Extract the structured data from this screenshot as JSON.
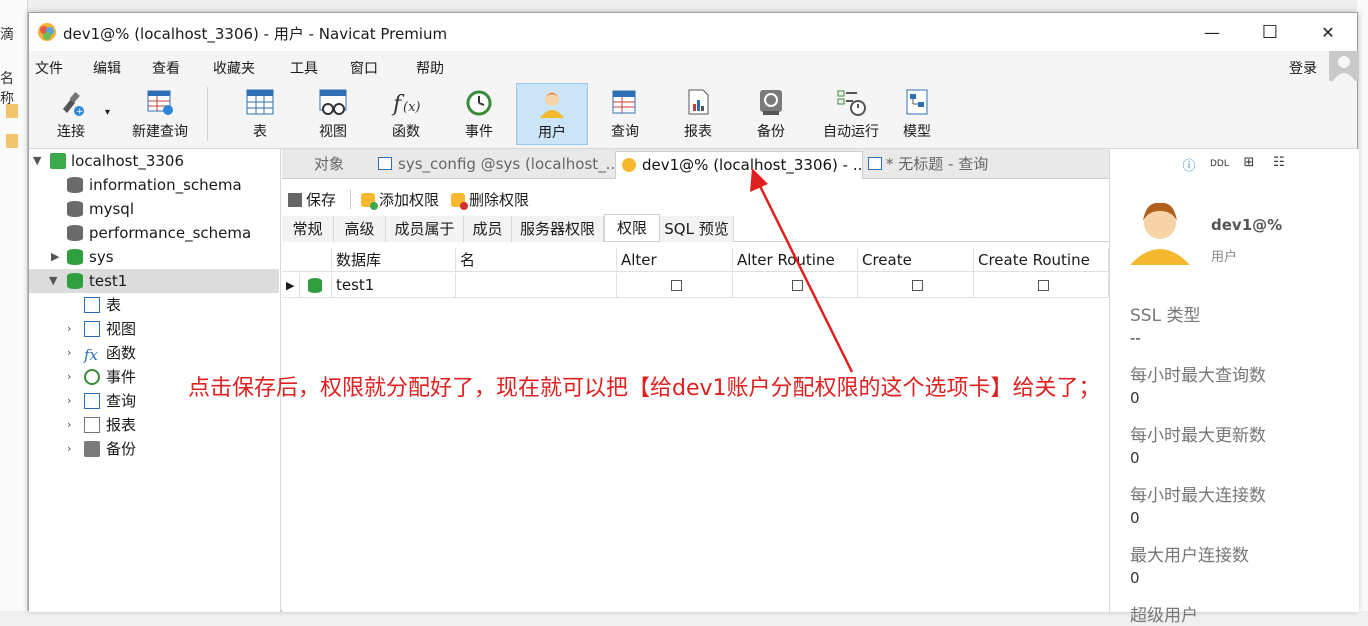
{
  "background": {
    "left_text_1": "滴",
    "left_text_2": "名称"
  },
  "window": {
    "title": "dev1@% (localhost_3306) - 用户 - Navicat Premium",
    "minimize": "—",
    "maximize": "☐",
    "close": "✕"
  },
  "menu": {
    "items": [
      "文件",
      "编辑",
      "查看",
      "收藏夹",
      "工具",
      "窗口",
      "帮助"
    ],
    "login": "登录"
  },
  "toolbar": {
    "items": [
      {
        "label": "连接",
        "icon": "connection-icon"
      },
      {
        "label": "新建查询",
        "icon": "new-query-icon"
      },
      {
        "label": "表",
        "icon": "table-icon"
      },
      {
        "label": "视图",
        "icon": "view-icon"
      },
      {
        "label": "函数",
        "icon": "function-icon"
      },
      {
        "label": "事件",
        "icon": "event-icon"
      },
      {
        "label": "用户",
        "icon": "user-icon"
      },
      {
        "label": "查询",
        "icon": "query-icon"
      },
      {
        "label": "报表",
        "icon": "report-icon"
      },
      {
        "label": "备份",
        "icon": "backup-icon"
      },
      {
        "label": "自动运行",
        "icon": "automation-icon"
      },
      {
        "label": "模型",
        "icon": "model-icon"
      }
    ],
    "active": "用户"
  },
  "tree": {
    "connection": "localhost_3306",
    "databases": [
      "information_schema",
      "mysql",
      "performance_schema",
      "sys",
      "test1"
    ],
    "selected": "test1",
    "children": [
      "表",
      "视图",
      "函数",
      "事件",
      "查询",
      "报表",
      "备份"
    ]
  },
  "tabs": {
    "items": [
      "对象",
      "sys_config @sys (localhost_...",
      "dev1@% (localhost_3306) - ...",
      "* 无标题 - 查询"
    ],
    "active_index": 2
  },
  "actions": {
    "save": "保存",
    "add_privilege": "添加权限",
    "delete_privilege": "删除权限"
  },
  "subtabs": {
    "items": [
      "常规",
      "高级",
      "成员属于",
      "成员",
      "服务器权限",
      "权限",
      "SQL 预览"
    ],
    "active": "权限"
  },
  "grid": {
    "columns": [
      "数据库",
      "名",
      "Alter",
      "Alter Routine",
      "Create",
      "Create Routine"
    ],
    "rows": [
      {
        "database": "test1",
        "name": "",
        "alter": false,
        "alter_routine": false,
        "create": false,
        "create_routine": false
      }
    ]
  },
  "annotation": "点击保存后，权限就分配好了，现在就可以把【给dev1账户分配权限的这个选项卡】给关了；",
  "info_panel": {
    "icons": [
      "info-icon",
      "ddl-icon",
      "er-icon",
      "properties-icon"
    ],
    "user_name": "dev1@%",
    "user_role": "用户",
    "fields": [
      {
        "label": "SSL 类型",
        "value": "--"
      },
      {
        "label": "每小时最大查询数",
        "value": "0"
      },
      {
        "label": "每小时最大更新数",
        "value": "0"
      },
      {
        "label": "每小时最大连接数",
        "value": "0"
      },
      {
        "label": "最大用户连接数",
        "value": "0"
      },
      {
        "label": "超级用户",
        "value": ""
      }
    ]
  },
  "colors": {
    "accent": "#cce4f7",
    "annotation": "#e02020",
    "db_green": "#2e9e3e"
  }
}
